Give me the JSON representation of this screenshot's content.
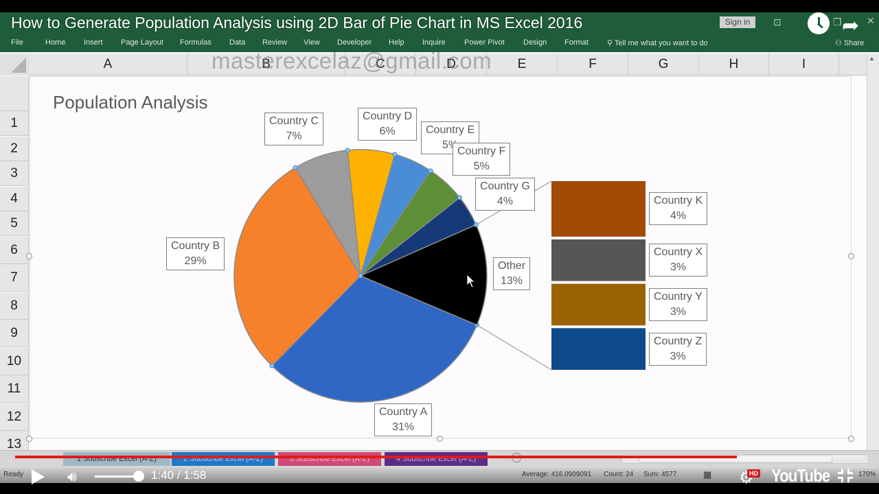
{
  "video": {
    "title": "How to Generate Population Analysis using 2D Bar of Pie Chart in MS Excel 2016",
    "time_current": "1:40",
    "time_total": "1:58",
    "time_display": "1:40 / 1:58",
    "progress_fraction": 0.85,
    "volume_fraction": 0.9,
    "hd_label": "HD",
    "brand": "YouTube"
  },
  "excel": {
    "sign_in": "Sign in",
    "ribbon_tabs": [
      "File",
      "Home",
      "Insert",
      "Page Layout",
      "Formulas",
      "Data",
      "Review",
      "View",
      "Developer",
      "Help",
      "Inquire",
      "Power Pivot",
      "Design",
      "Format"
    ],
    "tell_me": "Tell me what you want to do",
    "share": "Share",
    "watermark": "masterexcelaz@gmail.com",
    "columns": [
      "A",
      "B",
      "C",
      "D",
      "E",
      "F",
      "G",
      "H",
      "I"
    ],
    "rows": [
      "1",
      "2",
      "3",
      "4",
      "5",
      "6",
      "7",
      "8",
      "9",
      "10",
      "11",
      "12",
      "13"
    ],
    "sheet_tabs": [
      {
        "label": "1 Subscribe Excel (A-Z)",
        "color": "#9fb8c8"
      },
      {
        "label": "2 Subscribe Excel (A-Z)",
        "color": "#1f78c8"
      },
      {
        "label": "3 Subscribe Excel (A-Z)",
        "color": "#d04a78"
      },
      {
        "label": "4 Subscribe Excel (A-Z)",
        "color": "#5a2d88"
      }
    ],
    "status": {
      "ready": "Ready",
      "average": "Average: 416.0909091",
      "count": "Count: 24",
      "sum": "Sum: 4577",
      "zoom": "170%"
    }
  },
  "chart_data": {
    "type": "pie",
    "subtype": "bar-of-pie",
    "title": "Population Analysis",
    "pie": [
      {
        "name": "Country A",
        "percent": 31,
        "label": "31%",
        "color": "#3067c4"
      },
      {
        "name": "Country B",
        "percent": 29,
        "label": "29%",
        "color": "#f7812a"
      },
      {
        "name": "Country C",
        "percent": 7,
        "label": "7%",
        "color": "#9d9c9d"
      },
      {
        "name": "Country D",
        "percent": 6,
        "label": "6%",
        "color": "#fdb202"
      },
      {
        "name": "Country E",
        "percent": 5,
        "label": "5%",
        "color": "#4a8cd6"
      },
      {
        "name": "Country F",
        "percent": 5,
        "label": "5%",
        "color": "#5d8e38"
      },
      {
        "name": "Country G",
        "percent": 4,
        "label": "4%",
        "color": "#163a78"
      },
      {
        "name": "Other",
        "percent": 13,
        "label": "13%",
        "color": "#000000"
      }
    ],
    "bar": [
      {
        "name": "Country K",
        "percent": 4,
        "label": "4%",
        "color": "#a24a06"
      },
      {
        "name": "Country X",
        "percent": 3,
        "label": "3%",
        "color": "#585556"
      },
      {
        "name": "Country Y",
        "percent": 3,
        "label": "3%",
        "color": "#9a6303"
      },
      {
        "name": "Country Z",
        "percent": 3,
        "label": "3%",
        "color": "#0f4a8c"
      }
    ],
    "legend": "none"
  }
}
